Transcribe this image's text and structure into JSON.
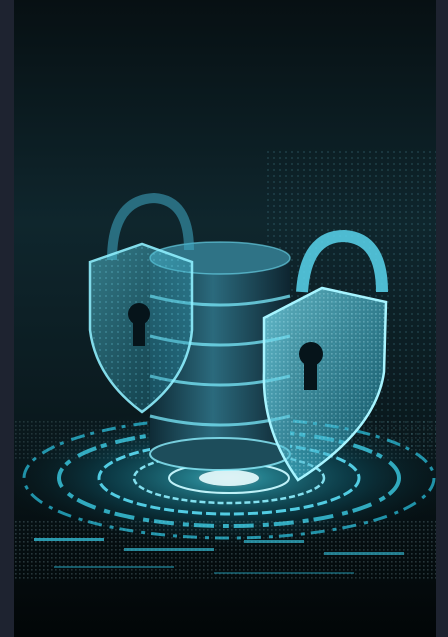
{
  "scene": {
    "subject": "cybersecurity-database-illustration",
    "palette": {
      "background_top": "#0a1216",
      "background_mid": "#10262d",
      "background_bottom": "#03080a",
      "glow": "#29d7f2",
      "accent": "#5fe6ff",
      "frame": "#1e2330"
    },
    "icons": [
      "shield-lock-icon",
      "database-icon",
      "padlock-icon",
      "keyhole-icon"
    ]
  }
}
